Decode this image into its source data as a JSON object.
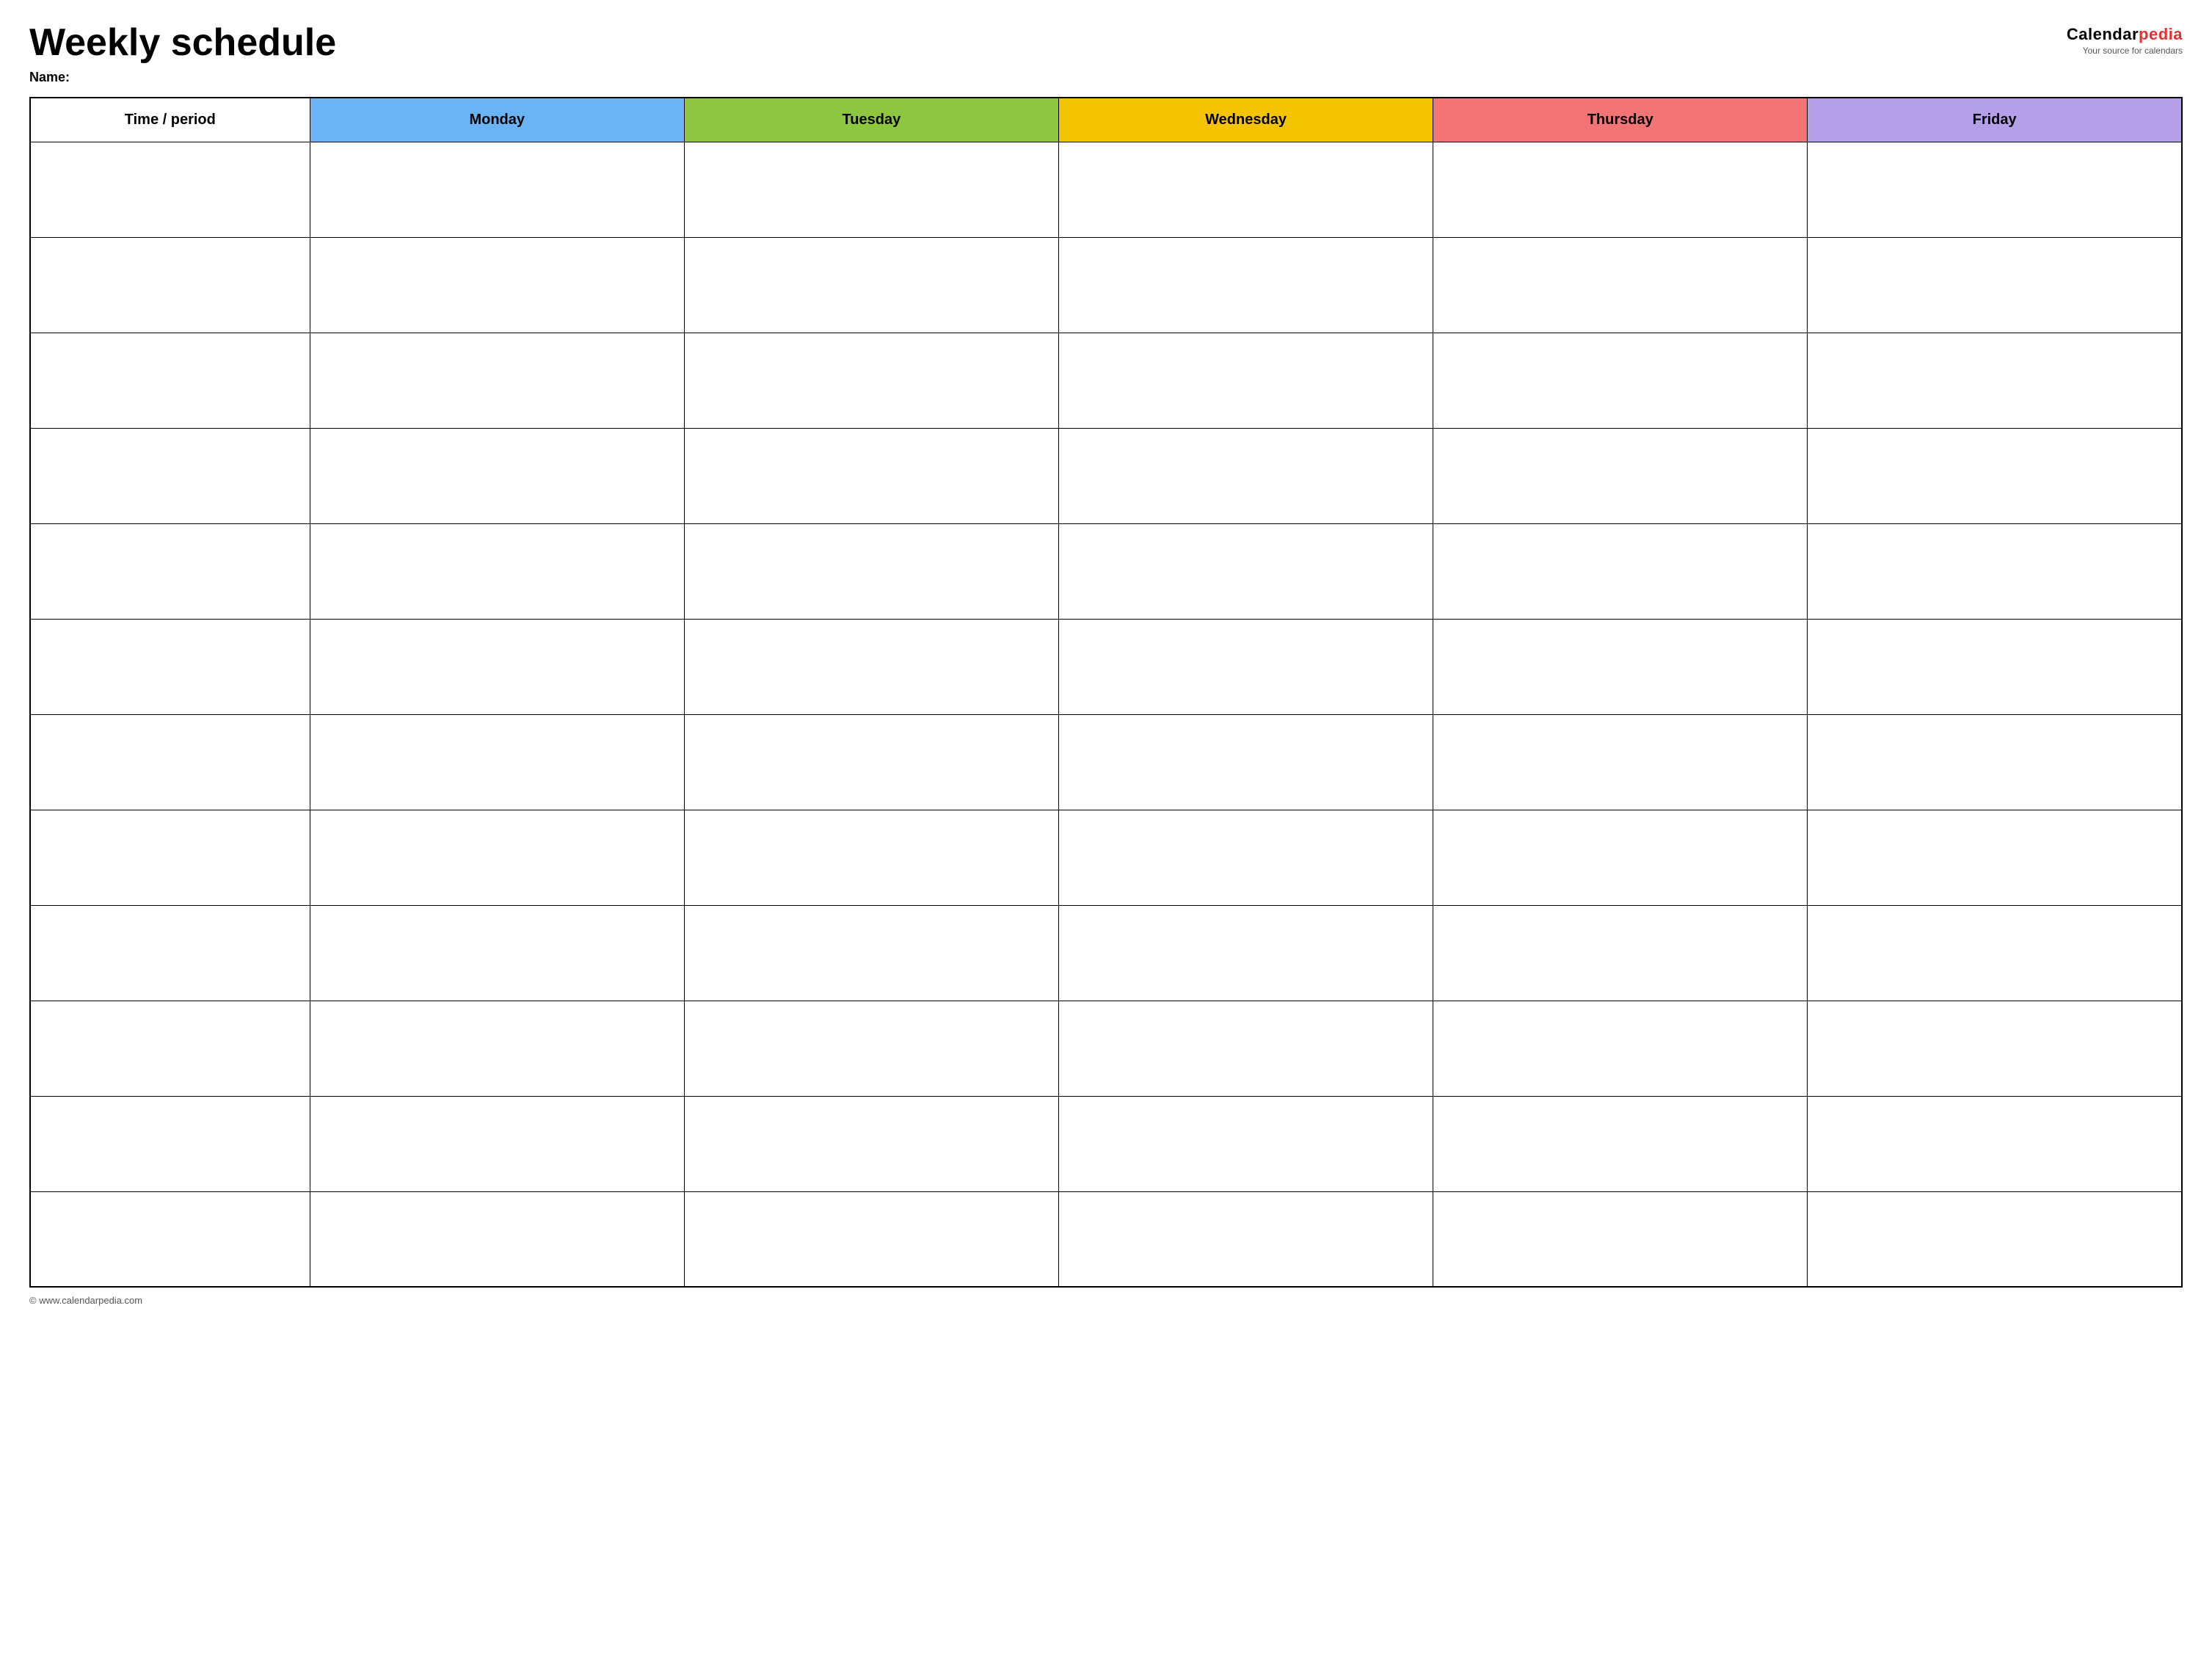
{
  "header": {
    "title": "Weekly schedule",
    "name_label": "Name:",
    "logo": {
      "calendar_part": "Calendar",
      "pedia_part": "pedia",
      "tagline": "Your source for calendars"
    }
  },
  "table": {
    "columns": [
      {
        "id": "time",
        "label": "Time / period",
        "color": "#ffffff"
      },
      {
        "id": "monday",
        "label": "Monday",
        "color": "#6ab4f5"
      },
      {
        "id": "tuesday",
        "label": "Tuesday",
        "color": "#8dc63f"
      },
      {
        "id": "wednesday",
        "label": "Wednesday",
        "color": "#f5c400"
      },
      {
        "id": "thursday",
        "label": "Thursday",
        "color": "#f27474"
      },
      {
        "id": "friday",
        "label": "Friday",
        "color": "#b59fe8"
      }
    ],
    "row_count": 12
  },
  "footer": {
    "copyright": "© www.calendarpedia.com"
  }
}
